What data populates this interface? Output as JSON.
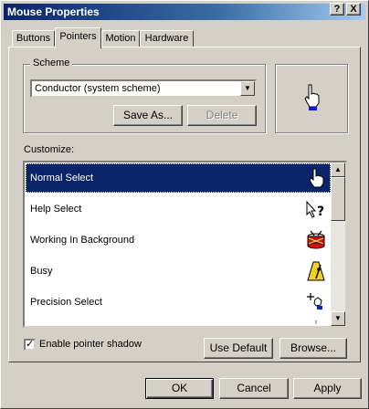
{
  "window": {
    "title": "Mouse Properties",
    "help_btn": "?",
    "close_btn": "X"
  },
  "tabs": [
    {
      "label": "Buttons",
      "active": false
    },
    {
      "label": "Pointers",
      "active": true
    },
    {
      "label": "Motion",
      "active": false
    },
    {
      "label": "Hardware",
      "active": false
    }
  ],
  "scheme": {
    "label": "Scheme",
    "selected": "Conductor (system scheme)",
    "save_as_label": "Save As...",
    "delete_label": "Delete"
  },
  "customize": {
    "label": "Customize:",
    "items": [
      {
        "label": "Normal Select",
        "icon": "hand-pointer-icon",
        "selected": true
      },
      {
        "label": "Help Select",
        "icon": "help-arrow-icon",
        "selected": false
      },
      {
        "label": "Working In Background",
        "icon": "drum-icon",
        "selected": false
      },
      {
        "label": "Busy",
        "icon": "metronome-icon",
        "selected": false
      },
      {
        "label": "Precision Select",
        "icon": "precision-crosshair-icon",
        "selected": false
      }
    ]
  },
  "shadow": {
    "label": "Enable pointer shadow",
    "checked": true
  },
  "buttons": {
    "use_default": "Use Default",
    "browse": "Browse...",
    "ok": "OK",
    "cancel": "Cancel",
    "apply": "Apply"
  },
  "colors": {
    "title_bar": "#0a246a",
    "selection": "#0a246a",
    "face": "#d4d0c8"
  }
}
